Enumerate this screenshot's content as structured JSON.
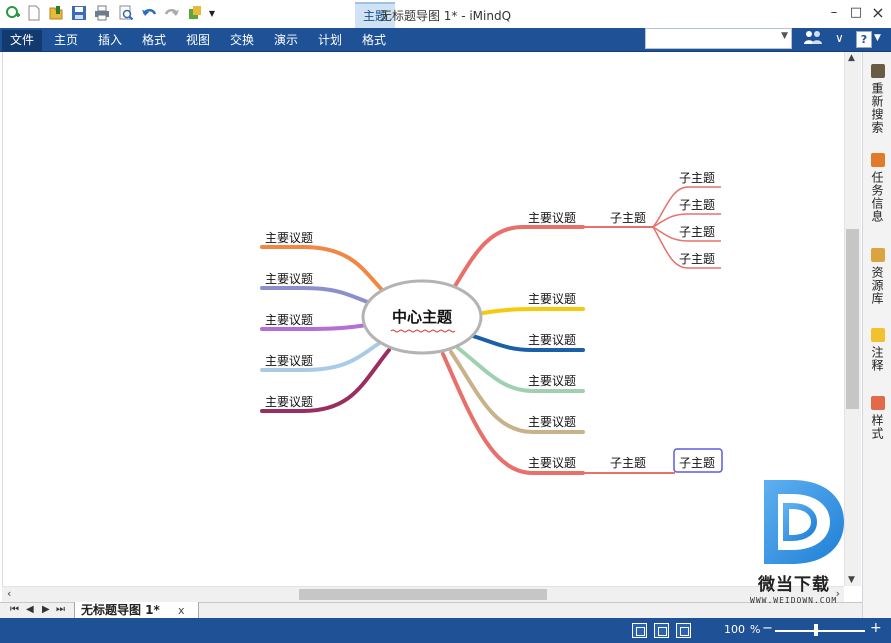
{
  "window": {
    "title": "无标题导图 1* - iMindQ",
    "context_tab": "主题",
    "controls": {
      "close": "×",
      "restore": "□",
      "minimize": "–"
    }
  },
  "quick_access": {
    "icons": [
      "new-topic-icon",
      "new-document-icon",
      "open-folder-icon",
      "save-icon",
      "print-icon",
      "print-preview-icon",
      "undo-icon",
      "redo-icon",
      "add-in-icon",
      "customize-toolbar-icon"
    ]
  },
  "menu": {
    "items": [
      "文件",
      "主页",
      "插入",
      "格式",
      "视图",
      "交换",
      "演示",
      "计划",
      "格式"
    ],
    "search_value": "",
    "help": "?"
  },
  "map": {
    "central": "中心主题",
    "left_topics": [
      "主要议题",
      "主要议题",
      "主要议题",
      "主要议题",
      "主要议题"
    ],
    "right_topics": [
      "主要议题",
      "主要议题",
      "主要议题",
      "主要议题",
      "主要议题",
      "主要议题"
    ],
    "subtopic_top": "子主题",
    "sub_subtopics_top": [
      "子主题",
      "子主题",
      "子主题",
      "子主题"
    ],
    "subtopic_bottom": "子主题",
    "sub_subtopic_bottom": "子主题",
    "branch_colors": {
      "left": [
        "#f08843",
        "#8d8fcc",
        "#b56ed3",
        "#a9cbe6",
        "#9a2e5e"
      ],
      "right": [
        "#e8706b",
        "#f6c90e",
        "#1a5fa8",
        "#9fd1b1",
        "#c8b28a",
        "#e8706b"
      ]
    }
  },
  "sidebar": {
    "panels": [
      {
        "label": "重新搜索",
        "icon": "search-again-icon",
        "color": "#6a5a48"
      },
      {
        "label": "任务信息",
        "icon": "task-info-icon",
        "color": "#e07b2e"
      },
      {
        "label": "资源库",
        "icon": "library-icon",
        "color": "#d9a441"
      },
      {
        "label": "注释",
        "icon": "notes-icon",
        "color": "#f2c12e"
      },
      {
        "label": "样式",
        "icon": "styles-icon",
        "color": "#e06a4a"
      }
    ]
  },
  "document_tabs": {
    "nav": [
      "⏮",
      "◀",
      "▶",
      "⏭"
    ],
    "active": "无标题导图 1*",
    "close": "x"
  },
  "status": {
    "zoom_value": "100",
    "zoom_unit": "%",
    "zoom_fraction": 0.46
  },
  "watermark": {
    "name": "微当下载",
    "url": "WWW.WEIDOWN.COM"
  }
}
